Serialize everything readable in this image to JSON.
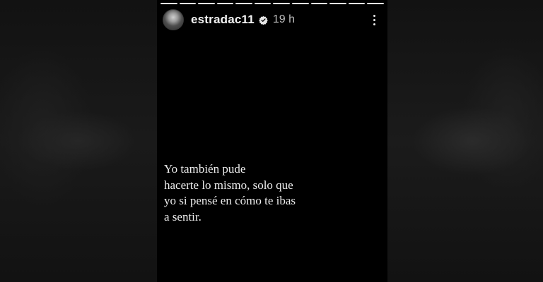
{
  "story": {
    "username": "estradac11",
    "verified": true,
    "timestamp": "19 h",
    "progress_segments": 12,
    "progress_completed": 12,
    "text": "Yo también pude\nhacerte lo mismo, solo que\nyo si pensé en cómo te ibas\na sentir."
  },
  "icons": {
    "avatar": "profile-avatar",
    "verified": "verified-badge-icon",
    "more": "more-options-icon"
  }
}
